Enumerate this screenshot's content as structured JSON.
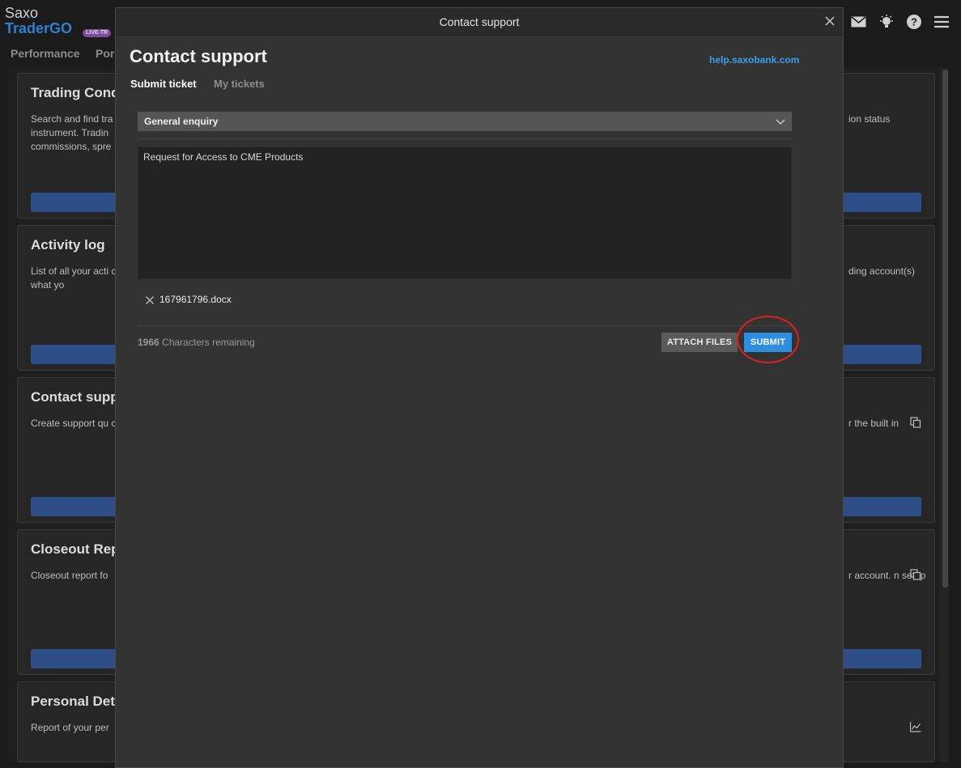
{
  "app": {
    "brand_top": "Saxo",
    "brand_name": "TraderGO",
    "brand_badge": "LIVE-TR",
    "nav_tabs": [
      "Performance",
      "Por"
    ]
  },
  "cards": [
    {
      "title": "Trading Cond",
      "desc": "Search and find tra instrument. Tradin commissions, spre",
      "desc_right": "ion status"
    },
    {
      "title": "Activity log",
      "desc": "List of all your acti confirming what yo",
      "desc_right": "ding account(s)"
    },
    {
      "title": "Contact supp",
      "desc": "Create support qu cases.",
      "desc_right": "r the built in"
    },
    {
      "title": "Closeout Rep",
      "desc": "Closeout report fo",
      "desc_right": "r account. n setup"
    },
    {
      "title": "Personal Deta",
      "desc": "Report of your per",
      "desc_right": ""
    }
  ],
  "modal": {
    "window_title": "Contact support",
    "heading": "Contact support",
    "help_link": "help.saxobank.com",
    "tabs": {
      "submit": "Submit ticket",
      "my": "My tickets"
    },
    "category": "General enquiry",
    "message": "Request for Access to CME Products",
    "attachment": "167961796.docx",
    "chars_remaining_count": "1966",
    "chars_remaining_label": "Characters remaining",
    "attach_label": "ATTACH FILES",
    "submit_label": "SUBMIT"
  },
  "colors": {
    "accent": "#2d8ee0",
    "link": "#3aa0e8",
    "highlight": "#e01f1f",
    "card_button": "#2d4e86"
  },
  "icons": [
    "mail-icon",
    "lightbulb-icon",
    "help-icon",
    "menu-icon",
    "close-icon",
    "chevron-down-icon",
    "remove-file-icon",
    "copy-icon",
    "chart-icon"
  ]
}
